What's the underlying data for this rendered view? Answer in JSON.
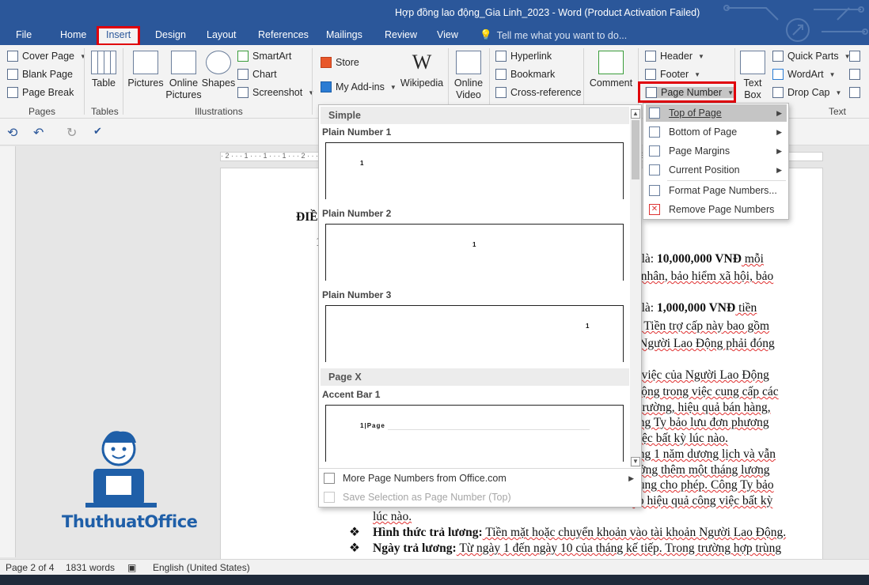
{
  "window": {
    "title": "Hợp đồng lao động_Gia Linh_2023 - Word (Product Activation Failed)"
  },
  "tabs": [
    {
      "label": "File"
    },
    {
      "label": "Home"
    },
    {
      "label": "Insert"
    },
    {
      "label": "Design"
    },
    {
      "label": "Layout"
    },
    {
      "label": "References"
    },
    {
      "label": "Mailings"
    },
    {
      "label": "Review"
    },
    {
      "label": "View"
    }
  ],
  "tellme": "Tell me what you want to do...",
  "ribbon": {
    "pages": {
      "label": "Pages",
      "cover_page": "Cover Page",
      "blank_page": "Blank Page",
      "page_break": "Page Break"
    },
    "tables": {
      "label": "Tables",
      "table": "Table"
    },
    "illustrations": {
      "label": "Illustrations",
      "pictures": "Pictures",
      "online_pictures": "Online Pictures",
      "shapes": "Shapes",
      "smartart": "SmartArt",
      "chart": "Chart",
      "screenshot": "Screenshot"
    },
    "addins": {
      "store": "Store",
      "my_addins": "My Add-ins",
      "wikipedia": "Wikipedia"
    },
    "media": {
      "online_video": "Online Video"
    },
    "links": {
      "hyperlink": "Hyperlink",
      "bookmark": "Bookmark",
      "cross_reference": "Cross-reference"
    },
    "comments": {
      "comment": "Comment"
    },
    "header_footer": {
      "header": "Header",
      "footer": "Footer",
      "page_number": "Page Number"
    },
    "text": {
      "label": "Text",
      "text_box": "Text Box",
      "quick_parts": "Quick Parts",
      "wordart": "WordArt",
      "drop_cap": "Drop Cap"
    }
  },
  "gallery": {
    "sections": [
      "Simple",
      "Page X"
    ],
    "items": [
      {
        "label": "Plain Number 1",
        "preview": "1"
      },
      {
        "label": "Plain Number 2",
        "preview": "1"
      },
      {
        "label": "Plain Number 3",
        "preview": "1"
      },
      {
        "label": "Accent Bar 1",
        "preview": "1|Page"
      }
    ],
    "more": "More Page Numbers from Office.com",
    "save": "Save Selection as Page Number (Top)"
  },
  "submenu": {
    "top_of_page": "Top of Page",
    "bottom_of_page": "Bottom of Page",
    "page_margins": "Page Margins",
    "current_position": "Current Position",
    "format": "Format Page Numbers...",
    "remove": "Remove Page Numbers"
  },
  "ruler": {
    "h_numbers": "· 2 · · · 1 · · · 1 · · · 1 · · · 2 · · · 3 · · · 4 · · · 5 · · · 6 · · · 7 · · · 8 · · · 9 · · · 10 · · · 11 · · · 12 · · · 13 · · · 14 · · · 15 · · · 16 · · · 17 · · · 18"
  },
  "document": {
    "heading_fragment": "ĐIỀ",
    "line_a": "1",
    "line1_pre": "g là: ",
    "line1_bold": "10,000,000 VNĐ",
    "line1_post": " mỗi",
    "line2": "á nhân, bảo hiểm xã hội, bảo",
    "line3_pre": "g là: ",
    "line3_bold": "1,000,000 VNĐ",
    "line3_post": " tiền",
    "line4": "a. Tiền trợ cấp này bao gồm",
    "line5": "i Người Lao Động phải đóng",
    "line6": "g việc của Người Lao Động",
    "line7": "Động trong việc cung cấp các",
    "line8": "ị trường, hiệu quả bán hàng,",
    "line9": "ông Ty bảo lưu đơn phương",
    "line10": "việc bất kỳ lúc nào.",
    "line11": "ong 1 năm dương lịch và vẫn",
    "line12": "ưởng thêm một tháng lương",
    "line13": "dụng cho phép. Công Ty bảo",
    "line14": "ấp hiệu quả công việc bất kỳ",
    "line15": "lúc nào.",
    "bullet1_label": "Hình thức trả lương:",
    "bullet1_text": " Tiền mặt hoặc chuyển khoản vào tài khoản Người Lao Động.",
    "bullet2_label": "Ngày trả lương:",
    "bullet2_text": " Từ ngày 1 đến ngày 10 của tháng kế tiếp. Trong trường hợp trùng"
  },
  "logo": {
    "text": "ThuthuatOffice"
  },
  "status": {
    "page": "Page 2 of 4",
    "words": "1831 words",
    "language": "English (United States)"
  }
}
